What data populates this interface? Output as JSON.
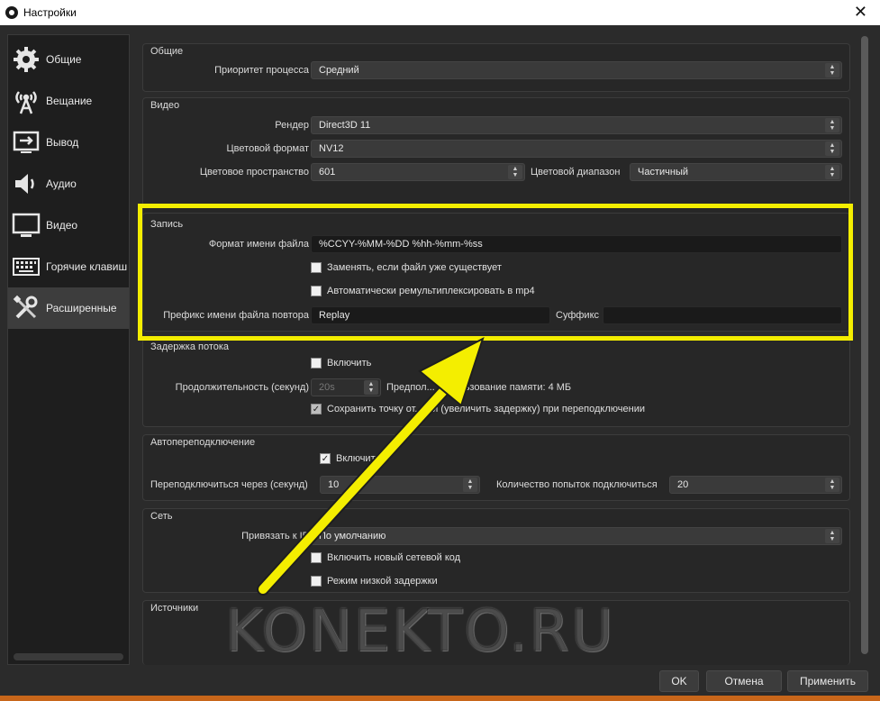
{
  "window": {
    "title": "Настройки",
    "close": "✕"
  },
  "sidebar": {
    "items": [
      {
        "label": "Общие",
        "icon": "gear-icon"
      },
      {
        "label": "Вещание",
        "icon": "broadcast-icon"
      },
      {
        "label": "Вывод",
        "icon": "output-icon"
      },
      {
        "label": "Аудио",
        "icon": "speaker-icon"
      },
      {
        "label": "Видео",
        "icon": "monitor-icon"
      },
      {
        "label": "Горячие клавиш",
        "icon": "keyboard-icon"
      },
      {
        "label": "Расширенные",
        "icon": "tools-icon"
      }
    ],
    "active_index": 6
  },
  "general": {
    "title": "Общие",
    "priority_label": "Приоритет процесса",
    "priority_value": "Средний"
  },
  "video": {
    "title": "Видео",
    "renderer_label": "Рендер",
    "renderer_value": "Direct3D 11",
    "color_format_label": "Цветовой формат",
    "color_format_value": "NV12",
    "color_space_label": "Цветовое пространство",
    "color_space_value": "601",
    "color_range_label": "Цветовой диапазон",
    "color_range_value": "Частичный"
  },
  "recording": {
    "title": "Запись",
    "filename_format_label": "Формат имени файла",
    "filename_format_value": "%CCYY-%MM-%DD %hh-%mm-%ss",
    "overwrite_label": "Заменять, если файл уже существует",
    "overwrite_checked": false,
    "remux_label": "Автоматически ремультиплексировать в mp4",
    "remux_checked": false,
    "replay_prefix_label": "Префикс имени файла повтора",
    "replay_prefix_value": "Replay",
    "suffix_label": "Суффикс",
    "suffix_value": ""
  },
  "stream_delay": {
    "title": "Задержка потока",
    "enable_label": "Включить",
    "enable_checked": false,
    "duration_label": "Продолжительность (секунд)",
    "duration_value": "20s",
    "memory_text": "Предпол... использование памяти: 4 МБ",
    "preserve_label": "Сохранить точку от...чки (увеличить задержку) при переподключении",
    "preserve_checked": true
  },
  "reconnect": {
    "title": "Автопереподключение",
    "enable_label": "Включить",
    "enable_checked": true,
    "retry_delay_label": "Переподключиться через (секунд)",
    "retry_delay_value": "10",
    "max_retries_label": "Количество попыток подключиться",
    "max_retries_value": "20"
  },
  "network": {
    "title": "Сеть",
    "bind_ip_label": "Привязать к IP",
    "bind_ip_value": "По умолчанию",
    "new_network_code_label": "Включить новый сетевой код",
    "new_network_code_checked": false,
    "low_latency_label": "Режим низкой задержки",
    "low_latency_checked": false
  },
  "sources": {
    "title": "Источники"
  },
  "buttons": {
    "ok": "OK",
    "cancel": "Отмена",
    "apply": "Применить"
  },
  "watermark": "KONEKTO.RU",
  "colors": {
    "highlight": "#f4ee00",
    "arrow": "#f4ee00",
    "background": "#2b2b2b"
  }
}
